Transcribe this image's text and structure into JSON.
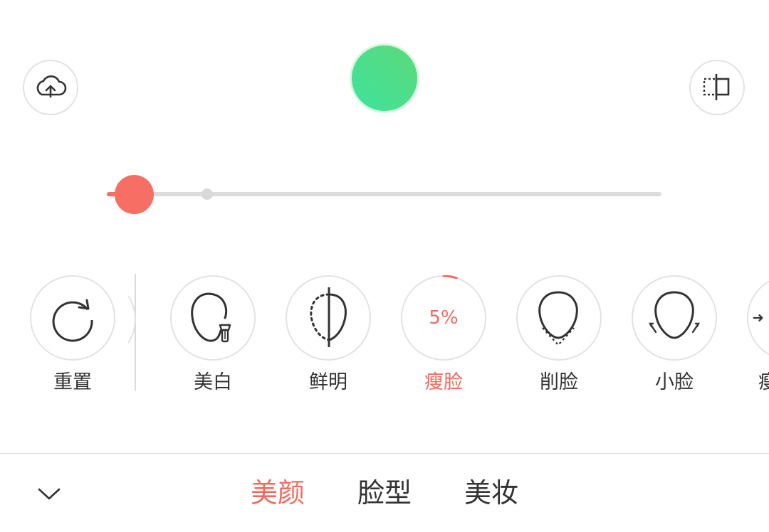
{
  "top_bar": {
    "upload_icon": "cloud-upload-icon",
    "compare_icon": "compare-split-icon",
    "capture_color": "#4ee38d"
  },
  "slider": {
    "value_fraction": 0.05,
    "accent": "#f76f64",
    "track_color": "#dcdcdc"
  },
  "tools": {
    "reset": {
      "label": "重置",
      "icon": "rotate-icon"
    },
    "items": [
      {
        "label": "美白",
        "icon": "face-whitening-icon"
      },
      {
        "label": "鲜明",
        "icon": "half-face-icon"
      },
      {
        "label": "瘦脸",
        "icon": "progress-ring",
        "value": "5%",
        "active": true
      },
      {
        "label": "削脸",
        "icon": "face-chin-icon"
      },
      {
        "label": "小脸",
        "icon": "small-face-icon"
      },
      {
        "label": "瘦",
        "icon": "arrow-icon"
      }
    ]
  },
  "bottom_tabs": [
    {
      "label": "美颜",
      "active": true
    },
    {
      "label": "脸型"
    },
    {
      "label": "美妆"
    }
  ],
  "colors": {
    "accent": "#f06a5e",
    "text": "#333333",
    "border": "#e2e2e2"
  }
}
